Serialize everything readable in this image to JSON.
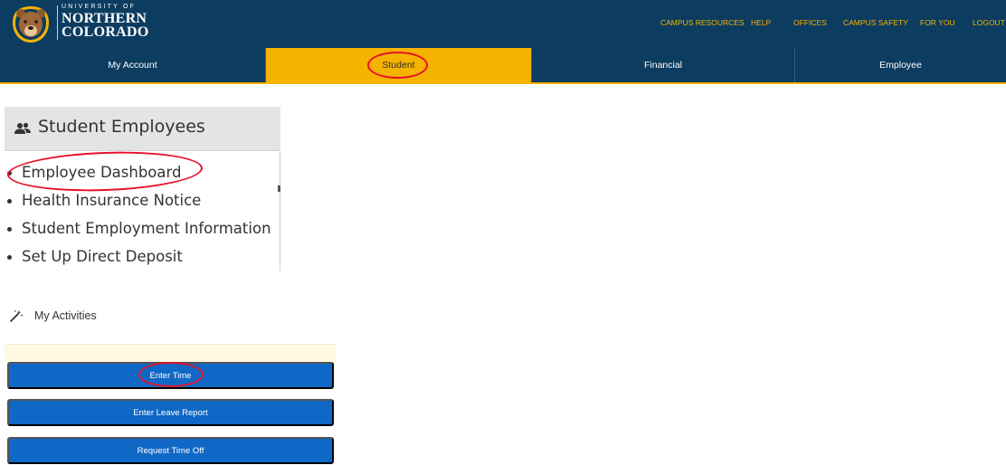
{
  "brand": {
    "line1": "UNIVERSITY OF",
    "line2": "NORTHERN",
    "line3": "COLORADO",
    "logo_icon": "bear-logo-icon",
    "colors": {
      "navy": "#0c3c60",
      "gold": "#f5b300",
      "button_blue": "#1068c6",
      "annotation_red": "#e8102a"
    }
  },
  "top_links": [
    "CAMPUS RESOURCES",
    "HELP",
    "OFFICES",
    "CAMPUS SAFETY",
    "FOR YOU",
    "LOGOUT"
  ],
  "nav": {
    "tabs": [
      {
        "label": "My Account",
        "active": false
      },
      {
        "label": "Student",
        "active": true
      },
      {
        "label": "Financial",
        "active": false
      },
      {
        "label": "Employee",
        "active": false
      }
    ]
  },
  "student_employees": {
    "icon": "users-icon",
    "title": "Student Employees",
    "items": [
      "Employee Dashboard",
      "Health Insurance Notice",
      "Student Employment Information",
      "Set Up Direct Deposit"
    ]
  },
  "activities": {
    "icon": "magic-wand-icon",
    "title": "My Activities",
    "buttons": [
      "Enter Time",
      "Enter Leave Report",
      "Request Time Off"
    ]
  }
}
